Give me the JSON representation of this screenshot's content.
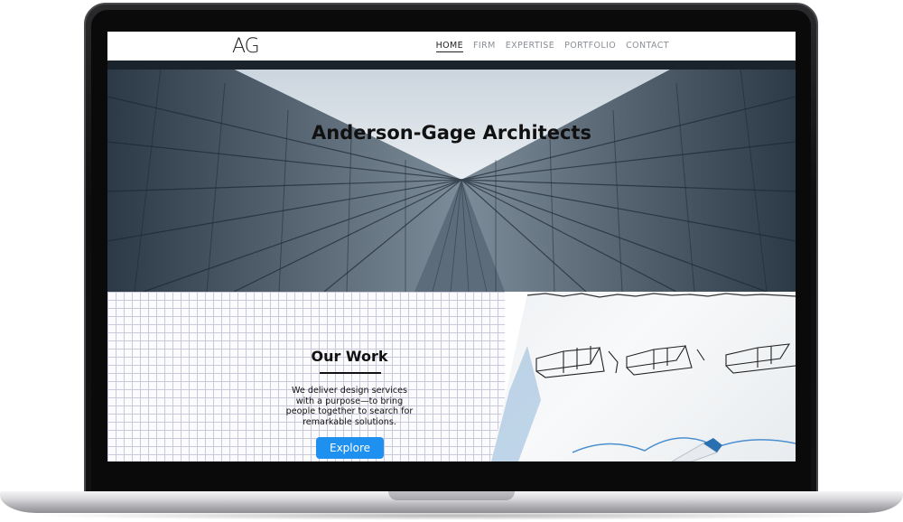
{
  "site": {
    "logo_text": "AG",
    "nav": [
      {
        "label": "HOME",
        "active": true
      },
      {
        "label": "FIRM",
        "active": false
      },
      {
        "label": "EXPERTISE",
        "active": false
      },
      {
        "label": "PORTFOLIO",
        "active": false
      },
      {
        "label": "CONTACT",
        "active": false
      }
    ]
  },
  "hero": {
    "title": "Anderson-Gage Architects"
  },
  "work": {
    "heading": "Our Work",
    "description": "We deliver design services with a purpose—to bring people together to search for remarkable solutions.",
    "button_label": "Explore"
  },
  "colors": {
    "accent": "#1e90f0",
    "nav_text": "#8a8f96",
    "nav_active": "#222222"
  }
}
